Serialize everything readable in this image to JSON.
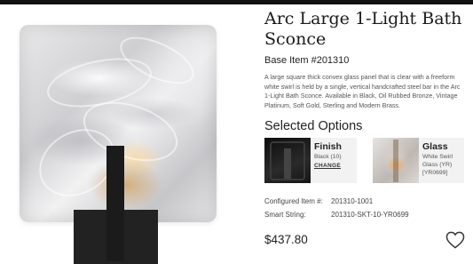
{
  "product": {
    "title": "Arc Large 1-Light Bath Sconce",
    "base_item": "Base Item #201310",
    "description": "A large square thick convex glass panel that is clear with a freeform white swirl is held by a single, vertical handcrafted steel bar in the Arc 1-Light Bath Sconce. Available in Black, Oil Rubbed Bronze, Vintage Platinum, Soft Gold, Sterling and Modern Brass."
  },
  "selected_options": {
    "heading": "Selected Options",
    "finish": {
      "name": "Finish",
      "value": "Black (10)",
      "change_label": "CHANGE"
    },
    "glass": {
      "name": "Glass",
      "value_line1": "White Swirl",
      "value_line2": "Glass (YR)",
      "value_line3": "[YR0699]"
    }
  },
  "details": {
    "configured_label": "Configured Item #:",
    "configured_value": "201310-1001",
    "smart_label": "Smart String:",
    "smart_value": "201310-SKT-10-YR0699"
  },
  "price": "$437.80",
  "icons": {
    "favorite": "heart-icon"
  },
  "colors": {
    "top_bar": "#111111",
    "finish_swatch": "#1b1b1b",
    "option_bg": "#f2f2f2"
  }
}
